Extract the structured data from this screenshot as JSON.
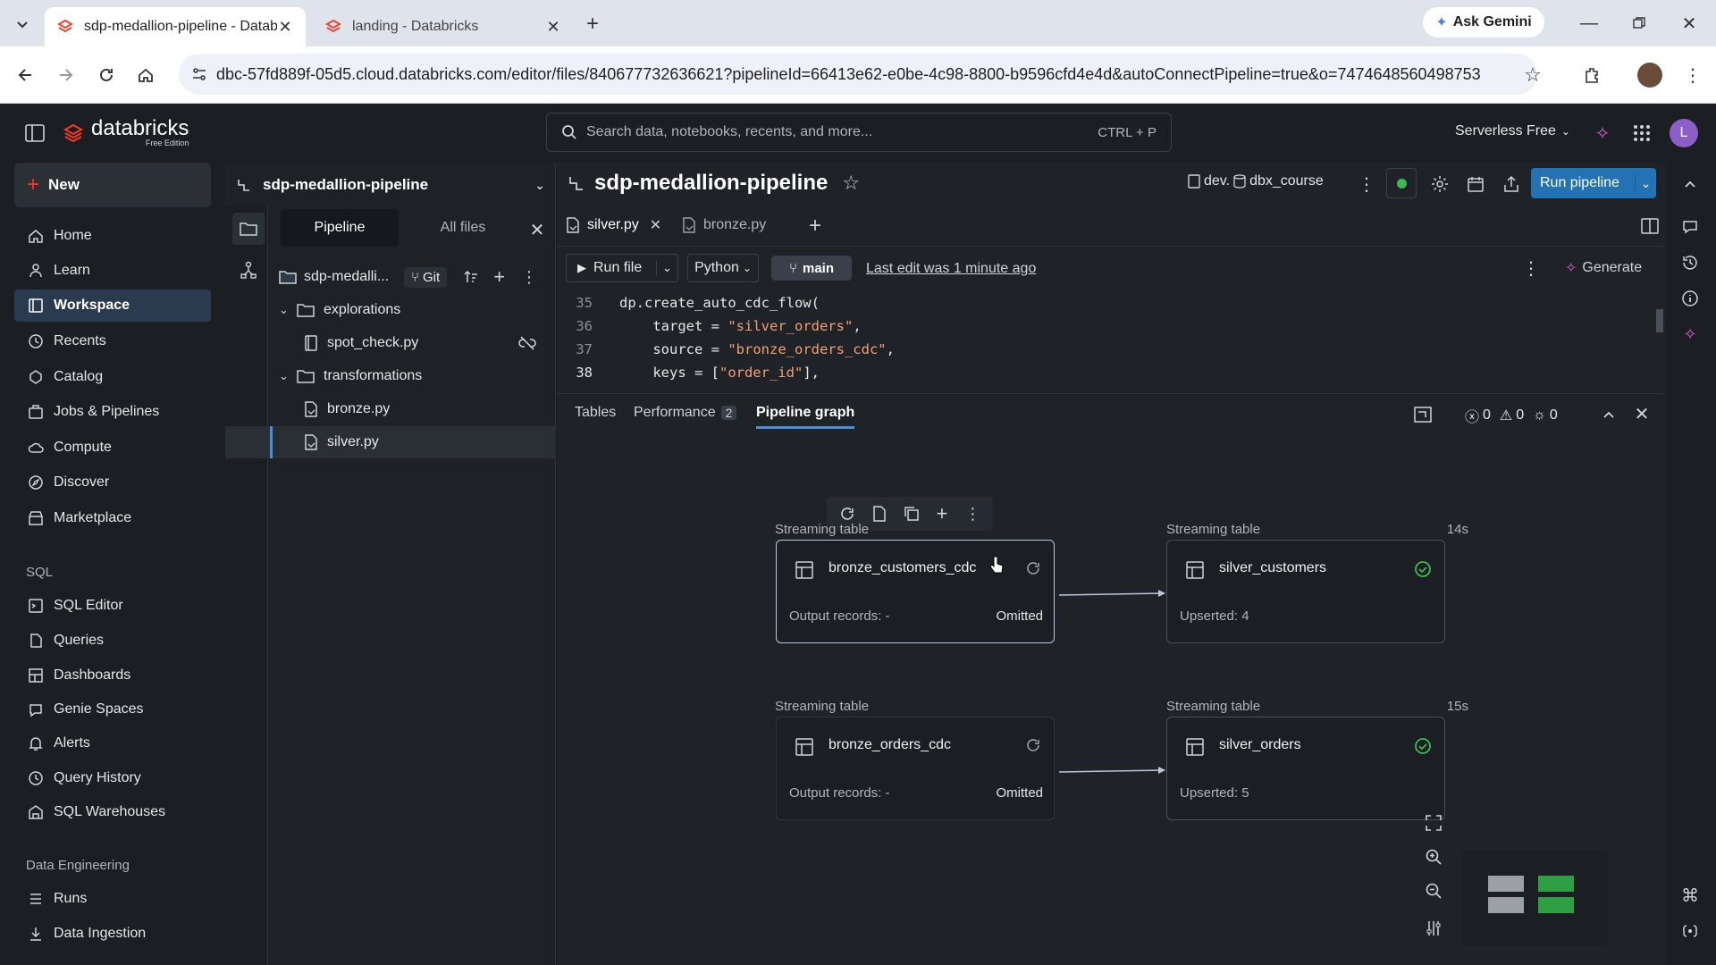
{
  "browser": {
    "tabs": [
      {
        "title": "sdp-medallion-pipeline - Datab",
        "active": true
      },
      {
        "title": "landing - Databricks",
        "active": false
      }
    ],
    "ask_gemini": "Ask Gemini",
    "url": "dbc-57fd889f-05d5.cloud.databricks.com/editor/files/840677732636621?pipelineId=66413e62-e0be-4c98-8800-b9596cfd4e4d&autoConnectPipeline=true&o=7474648560498753"
  },
  "topbar": {
    "brand": "databricks",
    "edition": "Free Edition",
    "search_placeholder": "Search data, notebooks, recents, and more...",
    "search_shortcut": "CTRL + P",
    "compute": "Serverless Free",
    "avatar": "L"
  },
  "leftnav": {
    "new_label": "New",
    "items": [
      {
        "label": "Home",
        "icon": "home-icon"
      },
      {
        "label": "Learn",
        "icon": "learn-icon"
      },
      {
        "label": "Workspace",
        "icon": "workspace-icon",
        "active": true
      },
      {
        "label": "Recents",
        "icon": "clock-icon"
      },
      {
        "label": "Catalog",
        "icon": "catalog-icon"
      },
      {
        "label": "Jobs & Pipelines",
        "icon": "jobs-icon"
      },
      {
        "label": "Compute",
        "icon": "cloud-icon"
      },
      {
        "label": "Discover",
        "icon": "compass-icon"
      },
      {
        "label": "Marketplace",
        "icon": "store-icon"
      }
    ],
    "sql_heading": "SQL",
    "sql_items": [
      {
        "label": "SQL Editor"
      },
      {
        "label": "Queries"
      },
      {
        "label": "Dashboards"
      },
      {
        "label": "Genie Spaces"
      },
      {
        "label": "Alerts"
      },
      {
        "label": "Query History"
      },
      {
        "label": "SQL Warehouses"
      }
    ],
    "de_heading": "Data Engineering",
    "de_items": [
      {
        "label": "Runs"
      },
      {
        "label": "Data Ingestion"
      }
    ]
  },
  "filepanel": {
    "pipeline_name": "sdp-medallion-pipeline",
    "tabs": [
      "Pipeline",
      "All files"
    ],
    "root_name": "sdp-medalli...",
    "git_label": "Git",
    "tree": [
      {
        "name": "explorations",
        "type": "folder"
      },
      {
        "name": "spot_check.py",
        "type": "notebook"
      },
      {
        "name": "transformations",
        "type": "folder"
      },
      {
        "name": "bronze.py",
        "type": "file"
      },
      {
        "name": "silver.py",
        "type": "file",
        "selected": true
      }
    ]
  },
  "editor": {
    "title": "sdp-medallion-pipeline",
    "catalog": "dev.",
    "schema": "dbx_course",
    "run_pipeline": "Run pipeline",
    "file_tabs": [
      {
        "name": "silver.py",
        "active": true
      },
      {
        "name": "bronze.py",
        "active": false
      }
    ],
    "run_file": "Run file",
    "language": "Python",
    "branch": "main",
    "last_edit": "Last edit was 1 minute ago",
    "generate": "Generate",
    "code": [
      {
        "ln": "35",
        "text": "dp.create_auto_cdc_flow("
      },
      {
        "ln": "36",
        "text": "    target = \"silver_orders\","
      },
      {
        "ln": "37",
        "text": "    source = \"bronze_orders_cdc\","
      },
      {
        "ln": "38",
        "text": "    keys = [\"order_id\"],"
      }
    ]
  },
  "bottom_panel": {
    "tabs": [
      {
        "label": "Tables"
      },
      {
        "label": "Performance",
        "badge": "2"
      },
      {
        "label": "Pipeline graph",
        "active": true
      }
    ],
    "errors": "0",
    "warnings": "0",
    "info": "0"
  },
  "graph": {
    "nodes": [
      {
        "type_label": "Streaming table",
        "name": "bronze_customers_cdc",
        "sub": "Output records: -",
        "status": "Omitted",
        "time": ""
      },
      {
        "type_label": "Streaming table",
        "name": "silver_customers",
        "sub": "Upserted: 4",
        "status": "",
        "time": "14s"
      },
      {
        "type_label": "Streaming table",
        "name": "bronze_orders_cdc",
        "sub": "Output records: -",
        "status": "Omitted",
        "time": ""
      },
      {
        "type_label": "Streaming table",
        "name": "silver_orders",
        "sub": "Upserted: 5",
        "status": "",
        "time": "15s"
      }
    ],
    "colors": {
      "success": "#3fb950",
      "accent": "#2272b4"
    }
  }
}
